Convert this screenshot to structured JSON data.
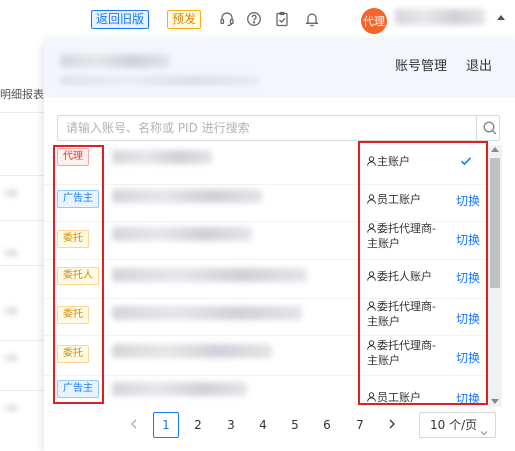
{
  "header": {
    "old_version_label": "返回旧版",
    "prerelease_label": "预发",
    "avatar_text": "代理"
  },
  "background": {
    "fragment_text": "明细报表"
  },
  "panel": {
    "manage_label": "账号管理",
    "logout_label": "退出"
  },
  "search": {
    "placeholder": "请输入账号、名称或 PID 进行搜索"
  },
  "accounts": [
    {
      "badge": "代理",
      "type_line1": "主账户",
      "type_line2": "",
      "action": "",
      "current": true
    },
    {
      "badge": "广告主",
      "type_line1": "员工账户",
      "type_line2": "",
      "action": "切换",
      "current": false
    },
    {
      "badge": "委托",
      "type_line1": "委托代理商-",
      "type_line2": "主账户",
      "action": "切换",
      "current": false
    },
    {
      "badge": "委托人",
      "type_line1": "委托人账户",
      "type_line2": "",
      "action": "切换",
      "current": false
    },
    {
      "badge": "委托",
      "type_line1": "委托代理商-",
      "type_line2": "主账户",
      "action": "切换",
      "current": false
    },
    {
      "badge": "委托",
      "type_line1": "委托代理商-",
      "type_line2": "主账户",
      "action": "切换",
      "current": false
    },
    {
      "badge": "广告主",
      "type_line1": "员工账户",
      "type_line2": "",
      "action": "切换",
      "current": false
    }
  ],
  "pagination": {
    "pages": [
      "1",
      "2",
      "3",
      "4",
      "5",
      "6",
      "7"
    ],
    "current_page": "1",
    "page_size_label": "10 个/页"
  },
  "colors": {
    "primary": "#1677ff",
    "highlight_border": "#e02020",
    "avatar_bg": "#f5642a"
  }
}
